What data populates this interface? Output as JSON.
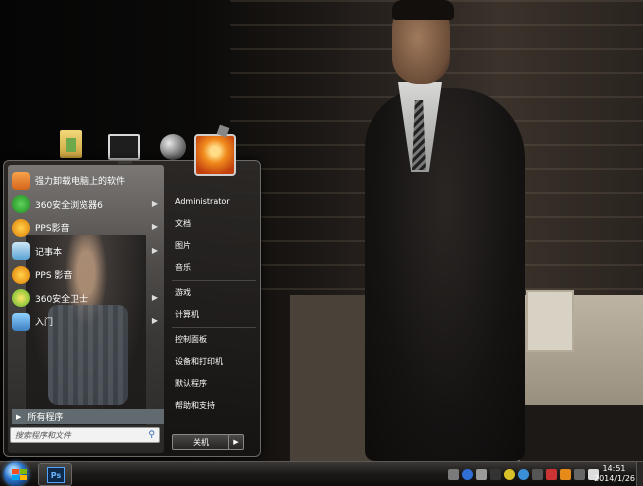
{
  "start_menu": {
    "pinned": [
      {
        "label": "强力卸载电脑上的软件",
        "icon": "uninstall-icon",
        "has_submenu": false
      },
      {
        "label": "360安全浏览器6",
        "icon": "360-browser-icon",
        "has_submenu": true
      },
      {
        "label": "PPS影音",
        "icon": "pps-icon",
        "has_submenu": true
      },
      {
        "label": "记事本",
        "icon": "notepad-icon",
        "has_submenu": true
      },
      {
        "label": "PPS 影音",
        "icon": "pps-icon",
        "has_submenu": false
      },
      {
        "label": "360安全卫士",
        "icon": "360-guard-icon",
        "has_submenu": true
      },
      {
        "label": "入门",
        "icon": "getting-started-icon",
        "has_submenu": true
      }
    ],
    "all_programs": "所有程序",
    "search_placeholder": "搜索程序和文件",
    "right": {
      "user": "Administrator",
      "documents": "文档",
      "pictures": "图片",
      "music": "音乐",
      "games": "游戏",
      "computer": "计算机",
      "control_panel": "控制面板",
      "devices": "设备和打印机",
      "default_programs": "默认程序",
      "help": "帮助和支持"
    },
    "shutdown": "关机"
  },
  "taskbar": {
    "ps_label": "Ps",
    "time": "14:51",
    "date": "2014/1/26"
  },
  "colors": {
    "accent": "#2a72c9",
    "menu_bg": "#2d2a28"
  }
}
